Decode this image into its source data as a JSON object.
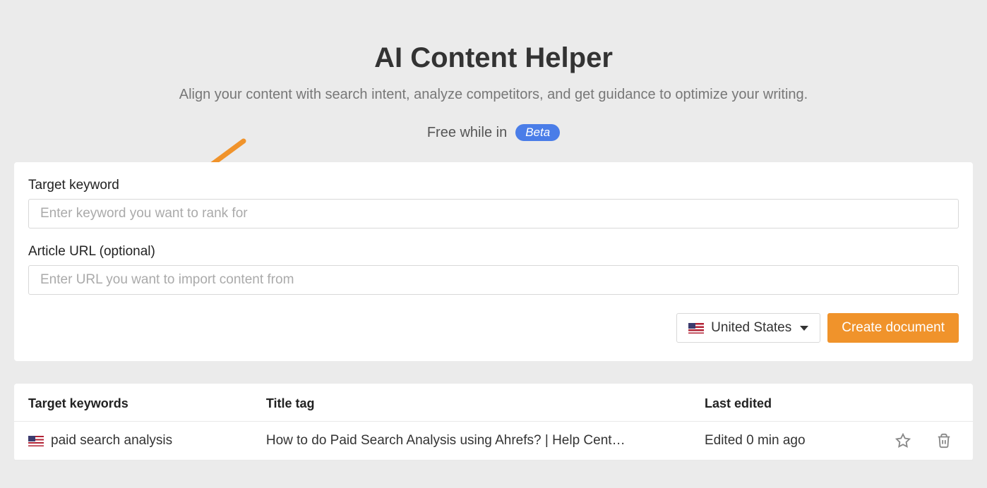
{
  "header": {
    "title": "AI Content Helper",
    "subtitle": "Align your content with search intent, analyze competitors, and get guidance to optimize your writing.",
    "beta_prefix": "Free while in",
    "beta_badge": "Beta"
  },
  "form": {
    "keyword_label": "Target keyword",
    "keyword_placeholder": "Enter keyword you want to rank for",
    "keyword_value": "",
    "url_label": "Article URL (optional)",
    "url_placeholder": "Enter URL you want to import content from",
    "url_value": "",
    "country_label": "United States",
    "create_button": "Create document"
  },
  "table": {
    "headers": {
      "keywords": "Target keywords",
      "title_tag": "Title tag",
      "last_edited": "Last edited"
    },
    "rows": [
      {
        "keyword": "paid search analysis",
        "title_tag": "How to do Paid Search Analysis using Ahrefs? | Help Cent…",
        "last_edited": "Edited 0 min ago"
      }
    ]
  },
  "colors": {
    "accent": "#f0932b",
    "badge": "#4a7de8",
    "arrow": "#f0932b"
  }
}
